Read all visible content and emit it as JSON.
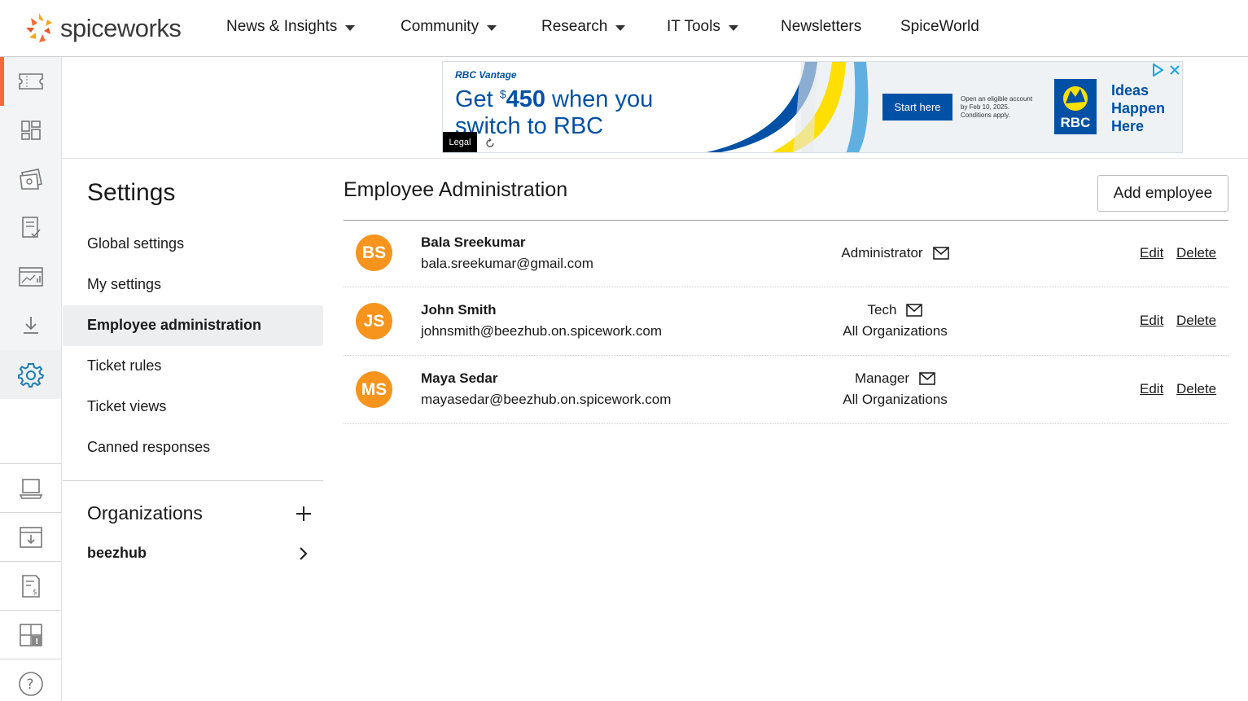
{
  "brand": {
    "logo_text": "spiceworks"
  },
  "nav": [
    {
      "label": "News & Insights",
      "dropdown": true
    },
    {
      "label": "Community",
      "dropdown": true
    },
    {
      "label": "Research",
      "dropdown": true
    },
    {
      "label": "IT Tools",
      "dropdown": true
    },
    {
      "label": "Newsletters",
      "dropdown": false
    },
    {
      "label": "SpiceWorld",
      "dropdown": false
    }
  ],
  "rail": [
    "tickets-icon",
    "dashboard-icon",
    "tickets-list-icon",
    "checklist-icon",
    "reports-icon",
    "download-icon",
    "settings-icon",
    "inventory-icon",
    "import-icon",
    "purchases-icon",
    "alerts-icon",
    "help-icon"
  ],
  "ad": {
    "brand_small": "RBC Vantage",
    "headline_pre": "Get ",
    "headline_super": "$",
    "headline_amount": "450",
    "headline_post": " when you",
    "headline_line2": "switch to RBC",
    "legal": "Legal",
    "cta": "Start here",
    "fine_print_1": "Open an eligible account",
    "fine_print_2": "by Feb 10, 2025.",
    "fine_print_3": "Conditions apply.",
    "logo_text": "RBC",
    "tagline_1": "Ideas",
    "tagline_2": "Happen",
    "tagline_3": "Here"
  },
  "settings": {
    "title": "Settings",
    "links": [
      "Global settings",
      "My settings",
      "Employee administration",
      "Ticket rules",
      "Ticket views",
      "Canned responses"
    ],
    "active_index": 2,
    "organizations_title": "Organizations",
    "organizations": [
      "beezhub"
    ]
  },
  "main": {
    "title": "Employee Administration",
    "add_button": "Add employee",
    "edit_label": "Edit",
    "delete_label": "Delete",
    "employees": [
      {
        "initials": "BS",
        "name": "Bala Sreekumar",
        "email": "bala.sreekumar@gmail.com",
        "role": "Administrator",
        "scope": ""
      },
      {
        "initials": "JS",
        "name": "John Smith",
        "email": "johnsmith@beezhub.on.spicework.com",
        "role": "Tech",
        "scope": "All Organizations"
      },
      {
        "initials": "MS",
        "name": "Maya Sedar",
        "email": "mayasedar@beezhub.on.spicework.com",
        "role": "Manager",
        "scope": "All Organizations"
      }
    ]
  },
  "colors": {
    "accent": "#f26b3a",
    "avatar": "#f7941d",
    "rbc_blue": "#0051a5",
    "rbc_yellow": "#fedf01"
  }
}
